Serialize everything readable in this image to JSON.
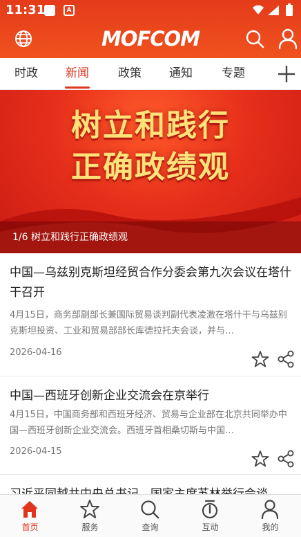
{
  "status_bar": {
    "time": "11:31",
    "notification_badge": "A"
  },
  "app_bar": {
    "logo": "MOFCOM",
    "icons": [
      "globe-icon",
      "search-icon",
      "user-icon"
    ]
  },
  "tabs": [
    {
      "label": "时政",
      "active": false
    },
    {
      "label": "新闻",
      "active": true
    },
    {
      "label": "政策",
      "active": false
    },
    {
      "label": "通知",
      "active": false
    },
    {
      "label": "专题",
      "active": false
    }
  ],
  "banner": {
    "headline_line1": "树立和践行",
    "headline_line2": "正确政绩观",
    "caption": "1/6 树立和践行正确政绩观"
  },
  "news": [
    {
      "title": "中国—乌兹别克斯坦经贸合作分委会第九次会议在塔什干召开",
      "summary": "4月15日，商务部副部长兼国际贸易谈判副代表凌激在塔什干与乌兹别克斯坦投资、工业和贸易部部长库德拉托夫会谈，并与…",
      "date": "2026-04-16"
    },
    {
      "title": "中国—西班牙创新企业交流会在京举行",
      "summary": "4月15日，中国商务部和西班牙经济、贸易与企业部在北京共同举办中国—西班牙创新企业交流会。西班牙首相桑切斯与中国…",
      "date": "2026-04-15"
    },
    {
      "title": "习近平同越共中央总书记、国家主席苏林举行会谈"
    }
  ],
  "bottom_nav": [
    {
      "label": "首页",
      "icon": "home-icon",
      "active": true
    },
    {
      "label": "服务",
      "icon": "star-icon",
      "active": false
    },
    {
      "label": "查询",
      "icon": "search-icon",
      "active": false
    },
    {
      "label": "互动",
      "icon": "interaction-icon",
      "active": false
    },
    {
      "label": "我的",
      "icon": "user-icon",
      "active": false
    }
  ],
  "colors": {
    "brand_red": "#e0351c",
    "header_orange": "#f0521f",
    "banner_text": "#ffe27a"
  }
}
